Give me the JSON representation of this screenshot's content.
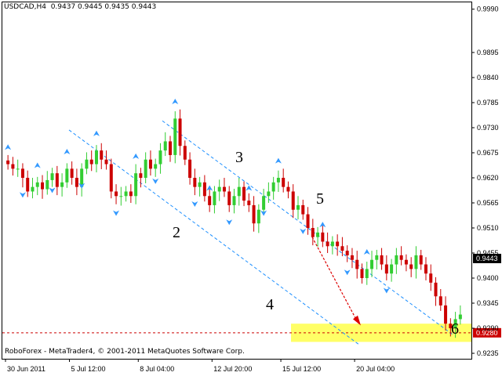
{
  "header": {
    "symbol": "USDCAD,H4",
    "ohlc": "0.9437 0.9445 0.9435 0.9443"
  },
  "footer": {
    "copyright": "RoboForex - MetaTrader4, © 2001-2011 MetaQuotes Software Corp."
  },
  "colors": {
    "bull_candle": "#32CD32",
    "bear_candle": "#CC0000",
    "fractal_arrow": "#3399FF",
    "channel_line": "#1E90FF",
    "target_zone": "#FFFF66",
    "target_line": "#CC0000",
    "current_price_tag": "#000000"
  },
  "chart_data": {
    "type": "candlestick",
    "symbol": "USDCAD",
    "timeframe": "H4",
    "ylim": [
      0.9223,
      1.0005
    ],
    "yticks": [
      "0.9990",
      "0.9895",
      "0.9840",
      "0.9785",
      "0.9730",
      "0.9675",
      "0.9620",
      "0.9565",
      "0.9510",
      "0.9455",
      "0.9400",
      "0.9345",
      "0.9290",
      "0.9235"
    ],
    "xticks": [
      "30 Jun 2011",
      "5 Jul 12:00",
      "8 Jul 04:00",
      "12 Jul 20:00",
      "15 Jul 12:00",
      "20 Jul 04:00"
    ],
    "current_price": "0.9443",
    "target_price": "0.9280",
    "target_zone": [
      0.926,
      0.93
    ],
    "wave_labels": [
      "2",
      "3",
      "4",
      "5",
      "6"
    ],
    "closes": [
      0.965,
      0.964,
      0.964,
      0.962,
      0.959,
      0.96,
      0.961,
      0.9595,
      0.9615,
      0.963,
      0.96,
      0.961,
      0.964,
      0.962,
      0.96,
      0.964,
      0.966,
      0.965,
      0.968,
      0.966,
      0.965,
      0.959,
      0.958,
      0.958,
      0.959,
      0.958,
      0.963,
      0.962,
      0.966,
      0.964,
      0.965,
      0.968,
      0.97,
      0.967,
      0.975,
      0.969,
      0.966,
      0.962,
      0.96,
      0.961,
      0.958,
      0.956,
      0.959,
      0.96,
      0.959,
      0.956,
      0.958,
      0.96,
      0.957,
      0.956,
      0.952,
      0.955,
      0.958,
      0.959,
      0.961,
      0.962,
      0.96,
      0.959,
      0.955,
      0.956,
      0.954,
      0.951,
      0.949,
      0.95,
      0.948,
      0.947,
      0.948,
      0.947,
      0.946,
      0.945,
      0.944,
      0.942,
      0.94,
      0.942,
      0.944,
      0.945,
      0.943,
      0.941,
      0.943,
      0.945,
      0.944,
      0.943,
      0.942,
      0.945,
      0.943,
      0.941,
      0.939,
      0.936,
      0.934,
      0.93,
      0.929,
      0.931,
      0.932
    ]
  },
  "annotations": {
    "label_2": "2",
    "label_3": "3",
    "label_4": "4",
    "label_5": "5",
    "label_6": "6"
  }
}
